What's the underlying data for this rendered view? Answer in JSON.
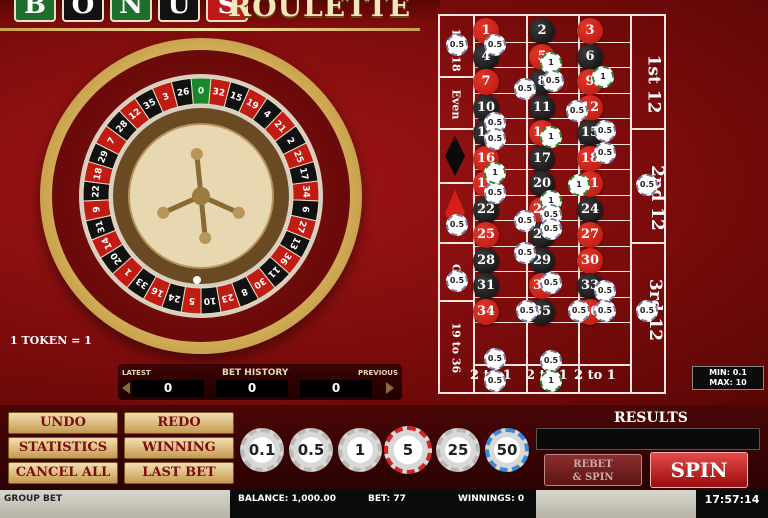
{
  "logo": {
    "letters": [
      "B",
      "O",
      "N",
      "U",
      "S"
    ],
    "word": "ROULETTE",
    "letter_colors": [
      "#1d6f2b",
      "#111111",
      "#1d6f2b",
      "#111111",
      "#c0171a"
    ]
  },
  "wheel": {
    "token_label": "1 TOKEN = 1",
    "pockets": [
      "0",
      "32",
      "15",
      "19",
      "4",
      "21",
      "2",
      "25",
      "17",
      "34",
      "6",
      "27",
      "13",
      "36",
      "11",
      "30",
      "8",
      "23",
      "10",
      "5",
      "24",
      "16",
      "33",
      "1",
      "20",
      "14",
      "31",
      "9",
      "22",
      "18",
      "29",
      "7",
      "28",
      "12",
      "35",
      "3",
      "26"
    ]
  },
  "grid": {
    "rows": [
      [
        "1",
        "2",
        "3"
      ],
      [
        "4",
        "5",
        "6"
      ],
      [
        "7",
        "8",
        "9"
      ],
      [
        "10",
        "11",
        "12"
      ],
      [
        "13",
        "14",
        "15"
      ],
      [
        "16",
        "17",
        "18"
      ],
      [
        "19",
        "20",
        "21"
      ],
      [
        "22",
        "23",
        "24"
      ],
      [
        "25",
        "26",
        "27"
      ],
      [
        "28",
        "29",
        "30"
      ],
      [
        "31",
        "32",
        "33"
      ],
      [
        "34",
        "35",
        "36"
      ]
    ],
    "red_numbers": [
      "1",
      "3",
      "5",
      "7",
      "9",
      "12",
      "14",
      "16",
      "18",
      "19",
      "21",
      "23",
      "25",
      "27",
      "30",
      "32",
      "34",
      "36"
    ],
    "outside_left": [
      "1 to 18",
      "Even",
      "",
      "",
      "Odd",
      "19 to 36"
    ],
    "dozens": [
      "1st 12",
      "2nd 12",
      "3rd 12"
    ],
    "columns": [
      "2 to 1",
      "2 to 1",
      "2 to 1"
    ],
    "chips": [
      {
        "v": "0.5"
      },
      {
        "v": "0.5"
      },
      {
        "v": "1"
      },
      {
        "v": "0.5"
      },
      {
        "v": "0.5"
      },
      {
        "v": "1"
      },
      {
        "v": "0.5"
      },
      {
        "v": "0.5"
      },
      {
        "v": "0.5"
      },
      {
        "v": "0.5"
      },
      {
        "v": "1"
      },
      {
        "v": "0.5"
      },
      {
        "v": "0.5"
      },
      {
        "v": "1"
      },
      {
        "v": "1"
      },
      {
        "v": "0.5"
      },
      {
        "v": "0.5"
      },
      {
        "v": "0.5"
      },
      {
        "v": "0.5"
      },
      {
        "v": "0.5"
      },
      {
        "v": "0.5"
      },
      {
        "v": "0.5"
      },
      {
        "v": "0.5"
      },
      {
        "v": "0.5"
      },
      {
        "v": "0.5"
      },
      {
        "v": "0.5"
      },
      {
        "v": "0.5"
      },
      {
        "v": "0.5"
      },
      {
        "v": "0.5"
      },
      {
        "v": "0.5"
      },
      {
        "v": "0.5"
      },
      {
        "v": "1"
      },
      {
        "v": "1"
      }
    ]
  },
  "limits": {
    "min": "MIN: 0.1",
    "max": "MAX: 10"
  },
  "history": {
    "latest": "LATEST",
    "title": "BET HISTORY",
    "previous": "PREVIOUS",
    "values": [
      "0",
      "0",
      "0"
    ]
  },
  "buttons": {
    "undo": "UNDO",
    "redo": "REDO",
    "statistics": "STATISTICS",
    "winning_bets": "WINNING BETS",
    "cancel_all": "CANCEL ALL",
    "last_bet": "LAST BET",
    "rebet_spin": [
      "REBET",
      "& SPIN"
    ],
    "spin": "SPIN"
  },
  "chip_values": [
    "0.1",
    "0.5",
    "1",
    "5",
    "25",
    "50"
  ],
  "selected_chip": "5",
  "results": {
    "label": "RESULTS"
  },
  "status": {
    "group_bet": "GROUP BET",
    "balance": "BALANCE: 1,000.00",
    "bet": "BET: 77",
    "winnings": "WINNINGS: 0",
    "clock": "17:57:14"
  }
}
